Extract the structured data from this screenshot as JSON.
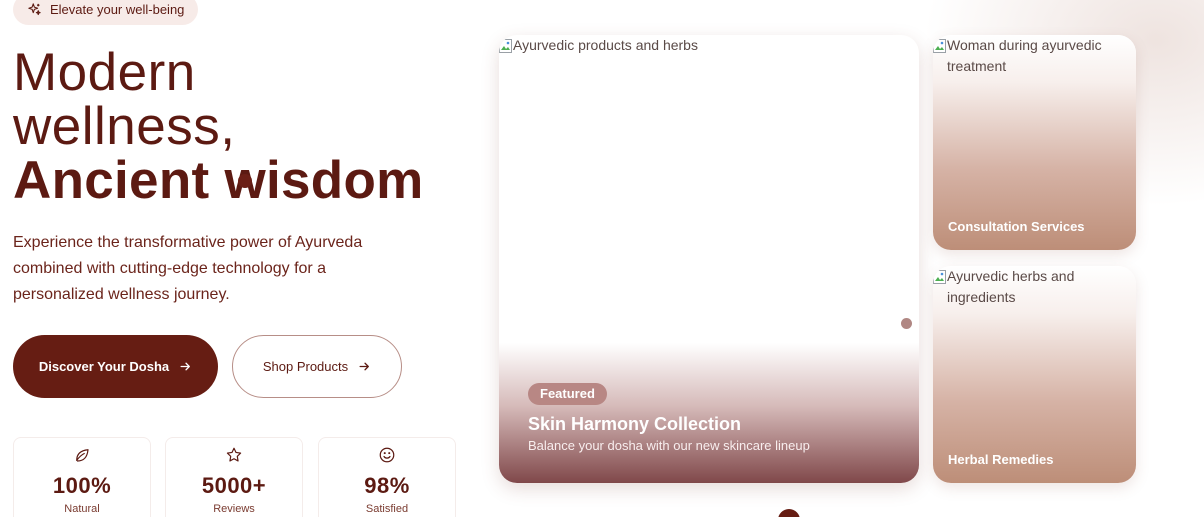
{
  "hero": {
    "tagline": "Elevate your well-being",
    "headline_line1": "Modern",
    "headline_line2": "wellness,",
    "headline_line3": "Ancient wisdom",
    "description": "Experience the transformative power of Ayurveda combined with cutting-edge technology for a personalized wellness journey.",
    "primary_button": "Discover Your Dosha",
    "secondary_button": "Shop Products"
  },
  "stats": [
    {
      "icon": "leaf-icon",
      "value": "100%",
      "label": "Natural"
    },
    {
      "icon": "star-icon",
      "value": "5000+",
      "label": "Reviews"
    },
    {
      "icon": "smile-icon",
      "value": "98%",
      "label": "Satisfied"
    }
  ],
  "featured_card": {
    "image_alt": "Ayurvedic products and herbs",
    "badge": "Featured",
    "title": "Skin Harmony Collection",
    "subtitle": "Balance your dosha with our new skincare lineup"
  },
  "side_cards": [
    {
      "image_alt": "Woman during ayurvedic treatment",
      "label": "Consultation Services"
    },
    {
      "image_alt": "Ayurvedic herbs and ingredients",
      "label": "Herbal Remedies"
    }
  ],
  "colors": {
    "brand": "#661d13",
    "text": "#5c1a12",
    "badge": "#b88784",
    "card_gradient_end": "#80484a"
  }
}
